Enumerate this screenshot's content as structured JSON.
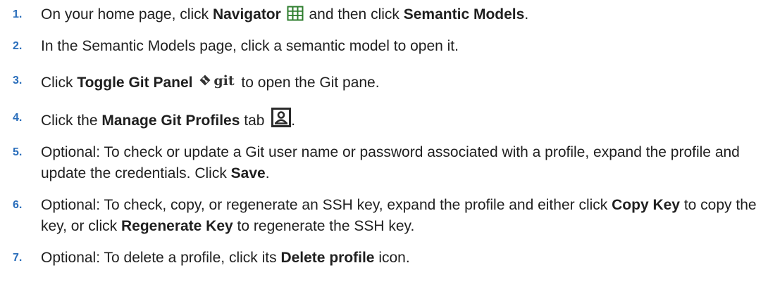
{
  "steps": [
    {
      "num": "1.",
      "t1": "On your home page, click ",
      "b1": "Navigator",
      "t2": " and then click ",
      "b2": "Semantic Models",
      "t3": "."
    },
    {
      "num": "2.",
      "t1": "In the Semantic Models page, click a semantic model to open it."
    },
    {
      "num": "3.",
      "t1": "Click ",
      "b1": "Toggle Git Panel",
      "icon_text": "git",
      "t2": " to open the Git pane."
    },
    {
      "num": "4.",
      "t1": "Click the ",
      "b1": "Manage Git Profiles",
      "t2": " tab",
      "t3": "."
    },
    {
      "num": "5.",
      "t1": "Optional: To check or update a Git user name or password associated with a profile, expand the profile and update the credentials. Click ",
      "b1": "Save",
      "t2": "."
    },
    {
      "num": "6.",
      "t1": "Optional: To check, copy, or regenerate an SSH key, expand the profile and either click ",
      "b1": "Copy Key",
      "t2": " to copy the key, or click ",
      "b2": "Regenerate Key",
      "t3": " to regenerate the SSH key."
    },
    {
      "num": "7.",
      "t1": "Optional: To delete a profile, click its ",
      "b1": "Delete profile",
      "t2": " icon."
    }
  ],
  "icons": {
    "navigator": "grid-icon",
    "git": "git-icon",
    "profile": "profile-card-icon"
  },
  "colors": {
    "step_number": "#2a6ebb",
    "navigator_icon": "#2e7d2e",
    "text": "#1f1f1f"
  }
}
